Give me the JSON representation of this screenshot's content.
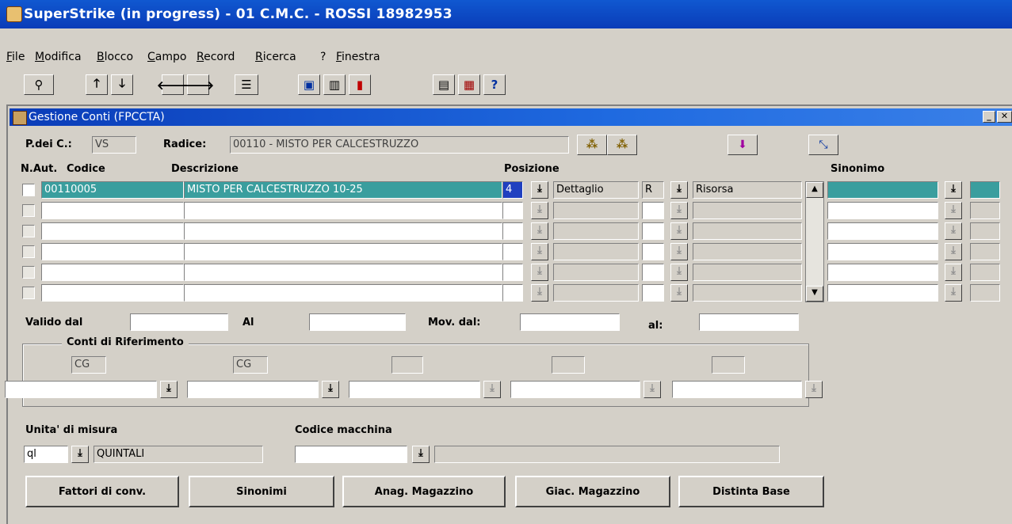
{
  "window": {
    "title": "SuperStrike (in progress) - 01 C.M.C. - ROSSI 18982953"
  },
  "menu": [
    {
      "pre": "",
      "u": "F",
      "post": "ile"
    },
    {
      "pre": "",
      "u": "M",
      "post": "odifica"
    },
    {
      "pre": "",
      "u": "B",
      "post": "locco"
    },
    {
      "pre": "",
      "u": "C",
      "post": "ampo"
    },
    {
      "pre": "",
      "u": "R",
      "post": "ecord"
    },
    {
      "pre": "",
      "u": "R",
      "post": "icerca"
    },
    {
      "pre": "?",
      "u": "",
      "post": ""
    },
    {
      "pre": "",
      "u": "F",
      "post": "inestra"
    }
  ],
  "toolbar": {
    "icons": [
      "enter-query-icon",
      "arrow-up-icon",
      "arrow-down-icon",
      "arrow-left-icon",
      "arrow-right-icon",
      "list-icon",
      "save-icon",
      "clear-icon",
      "exit-icon",
      "paste-icon",
      "copy-icon",
      "help-icon"
    ],
    "glyphs": [
      "⚲",
      "🡑",
      "🡓",
      "🡐",
      "🡒",
      "☰",
      "▣",
      "▥",
      "▮",
      "▤",
      "▦",
      "?"
    ]
  },
  "form": {
    "title": "Gestione Conti (FPCCTA)",
    "pdc_label": "P.dei C.:",
    "pdc_value": "VS",
    "radice_label": "Radice:",
    "radice_value": "00110 - MISTO PER CALCESTRUZZO",
    "headers": {
      "naut": "N.Aut.",
      "codice": "Codice",
      "descrizione": "Descrizione",
      "posizione": "Posizione",
      "sinonimo": "Sinonimo"
    },
    "rows": [
      {
        "codice": "00110005",
        "descrizione": "MISTO PER CALCESTRUZZO 10-25",
        "pos_num": "4",
        "pos_tipo": "Dettaglio",
        "ris_code": "R",
        "ris_desc": "Risorsa",
        "sinonimo": ""
      },
      {
        "codice": "",
        "descrizione": "",
        "pos_num": "",
        "pos_tipo": "",
        "ris_code": "",
        "ris_desc": "",
        "sinonimo": ""
      },
      {
        "codice": "",
        "descrizione": "",
        "pos_num": "",
        "pos_tipo": "",
        "ris_code": "",
        "ris_desc": "",
        "sinonimo": ""
      },
      {
        "codice": "",
        "descrizione": "",
        "pos_num": "",
        "pos_tipo": "",
        "ris_code": "",
        "ris_desc": "",
        "sinonimo": ""
      },
      {
        "codice": "",
        "descrizione": "",
        "pos_num": "",
        "pos_tipo": "",
        "ris_code": "",
        "ris_desc": "",
        "sinonimo": ""
      },
      {
        "codice": "",
        "descrizione": "",
        "pos_num": "",
        "pos_tipo": "",
        "ris_code": "",
        "ris_desc": "",
        "sinonimo": ""
      }
    ],
    "valido_dal_label": "Valido dal",
    "al_label": "Al",
    "mov_dal_label": "Mov. dal:",
    "al2_label": "al:",
    "valido_dal": "",
    "al": "",
    "mov_dal": "",
    "al2": "",
    "conti_label": "Conti di Riferimento",
    "conti_codes": [
      "CG",
      "CG",
      "",
      "",
      ""
    ],
    "conti_values": [
      "",
      "",
      "",
      "",
      ""
    ],
    "unita_label": "Unita' di misura",
    "unita_code": "ql",
    "unita_desc": "QUINTALI",
    "macchina_label": "Codice macchina",
    "macchina_code": "",
    "macchina_desc": ""
  },
  "buttons": {
    "fattori": "Fattori di conv.",
    "sinonimi": "Sinonimi",
    "anag": "Anag. Magazzino",
    "giac": "Giac. Magazzino",
    "distinta": "Distinta Base"
  },
  "colors": {
    "title_bar": "#0a3cb8",
    "selected_row": "#3a9e9e",
    "background": "#d4d0c8"
  }
}
